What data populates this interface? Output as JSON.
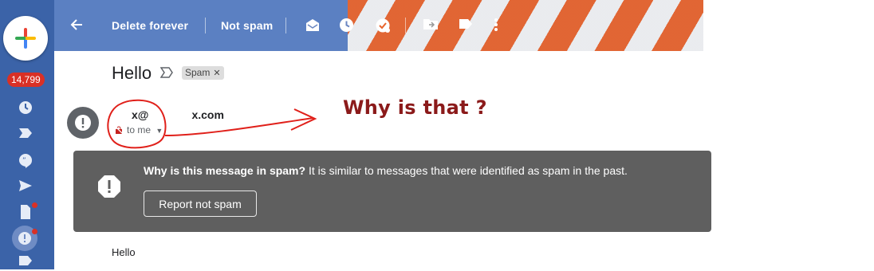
{
  "rail": {
    "unread_count": "14,799"
  },
  "toolbar": {
    "back_icon": "arrow-back-icon",
    "delete_forever": "Delete forever",
    "not_spam": "Not spam",
    "icons": [
      "mark-unread-icon",
      "snooze-clock-icon",
      "add-task-icon",
      "move-to-icon",
      "label-icon",
      "more-vert-icon"
    ]
  },
  "message": {
    "subject": "Hello",
    "label_chip": "Spam",
    "sender_prefix": "x@",
    "sender_suffix": "x.com",
    "recipient": "to me",
    "body": "Hello"
  },
  "spam_banner": {
    "reason_bold": "Why is this message in spam?",
    "reason_text": " It is similar to messages that were identified as spam in the past.",
    "report_button": "Report not spam"
  },
  "annotation": {
    "text": "Why is that ?",
    "color": "#8b1a1a"
  }
}
